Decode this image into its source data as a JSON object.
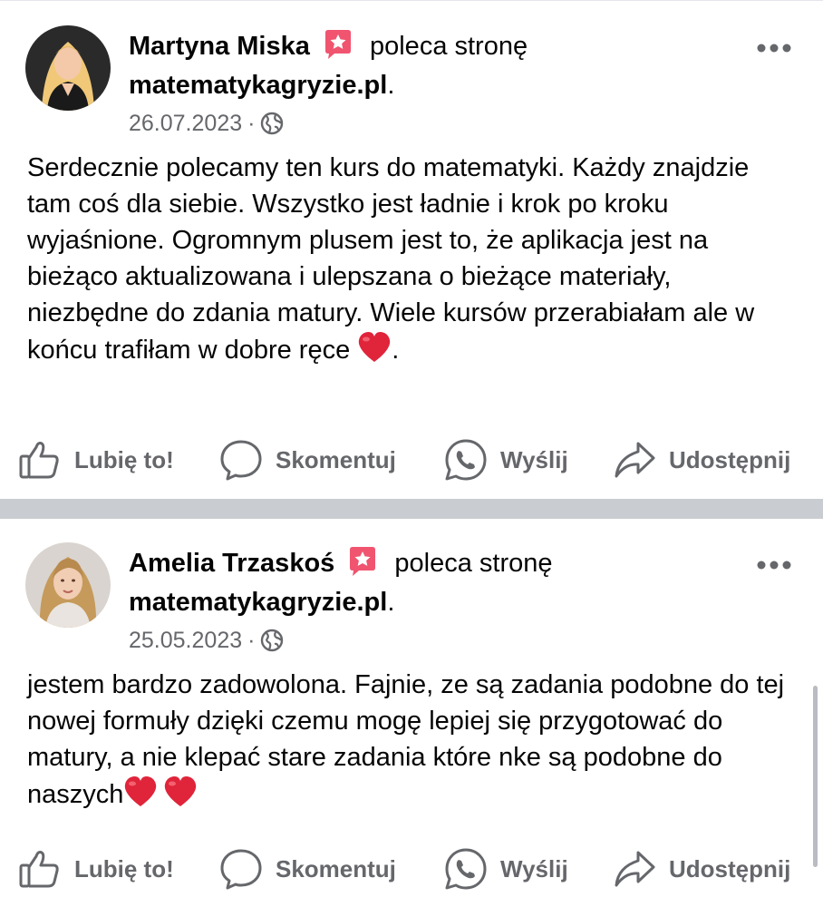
{
  "posts": [
    {
      "author": "Martyna Miska",
      "action": "poleca stronę",
      "page": "matematykagryzie.pl",
      "date": "26.07.2023",
      "separator": "·",
      "text": "Serdecznie polecamy ten kurs do matematyki. Każdy znajdzie tam coś dla siebie. Wszystko jest ładnie i krok po kroku wyjaśnione. Ogromnym plusem jest to, że aplikacja jest na bieżąco aktualizowana i ulepszana o bieżące materiały, niezbędne do zdania matury. Wiele kursów przerabiałam ale w końcu trafiłam w dobre ręce ",
      "text_end": ".",
      "avatar_colors": {
        "background": "#2a2a2a",
        "hair": "#f0c878",
        "skin": "#f3c9a9",
        "clothing": "#1a1a1a"
      }
    },
    {
      "author": "Amelia Trzaskoś",
      "action": "poleca stronę",
      "page": "matematykagryzie.pl",
      "date": "25.05.2023",
      "separator": "·",
      "text": "jestem bardzo zadowolona. Fajnie, ze są zadania podobne do tej nowej formuły dzięki czemu mogę lepiej się przygotować do matury, a nie klepać stare zadania które nke są podobne do naszych",
      "text_end": "",
      "avatar_colors": {
        "background": "#d9d4cf",
        "hair": "#c59a5b",
        "skin": "#f1cdb4",
        "clothing": "#e9e4df"
      }
    }
  ],
  "actions": {
    "like": "Lubię to!",
    "comment": "Skomentuj",
    "send": "Wyślij",
    "share": "Udostępnij"
  },
  "icons": {
    "recommend_badge": "star-speech-bubble-icon",
    "privacy": "globe-icon",
    "more": "ellipsis-icon",
    "like": "thumbs-up-icon",
    "comment": "comment-bubble-icon",
    "send": "whatsapp-icon",
    "share": "share-arrow-icon",
    "emoji": "red-heart-icon"
  },
  "colors": {
    "badge": "#f0546f",
    "heart": "#e0243a",
    "secondary_text": "#65676b",
    "divider": "#c9ccd1"
  }
}
